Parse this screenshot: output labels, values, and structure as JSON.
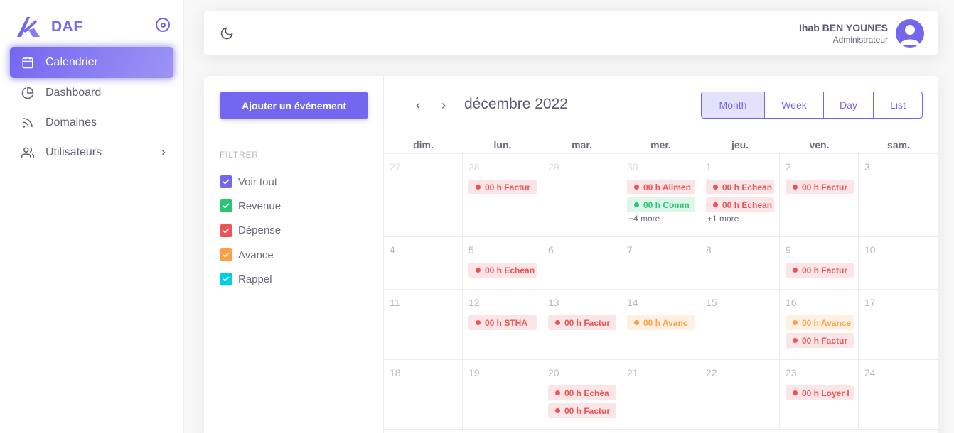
{
  "brand": {
    "name": "DAF"
  },
  "sidebar": {
    "items": [
      {
        "label": "Calendrier",
        "icon": "calendar-icon",
        "active": true
      },
      {
        "label": "Dashboard",
        "icon": "pie-chart-icon"
      },
      {
        "label": "Domaines",
        "icon": "rss-icon"
      },
      {
        "label": "Utilisateurs",
        "icon": "users-icon"
      }
    ]
  },
  "header": {
    "user_name": "Ihab BEN YOUNES",
    "user_role": "Administrateur"
  },
  "calendar": {
    "add_button": "Ajouter un événement",
    "filter_title": "FILTRER",
    "filters": [
      {
        "label": "Voir tout",
        "color": "#7367f0",
        "checked": true
      },
      {
        "label": "Revenue",
        "color": "#28c76f",
        "checked": true
      },
      {
        "label": "Dépense",
        "color": "#ea5455",
        "checked": true
      },
      {
        "label": "Avance",
        "color": "#ff9f43",
        "checked": true
      },
      {
        "label": "Rappel",
        "color": "#00cfe8",
        "checked": true
      }
    ],
    "title": "décembre 2022",
    "views": [
      "Month",
      "Week",
      "Day",
      "List"
    ],
    "active_view": "Month",
    "weekdays": [
      "dim.",
      "lun.",
      "mar.",
      "mer.",
      "jeu.",
      "ven.",
      "sam."
    ],
    "weeks": [
      [
        {
          "d": "27",
          "other": true,
          "events": []
        },
        {
          "d": "28",
          "other": true,
          "events": [
            {
              "t": "00 h Factur",
              "c": "red"
            }
          ]
        },
        {
          "d": "29",
          "other": true,
          "events": []
        },
        {
          "d": "30",
          "other": true,
          "events": [
            {
              "t": "00 h Alimen",
              "c": "red"
            },
            {
              "t": "00 h Comm",
              "c": "green"
            }
          ],
          "more": "+4 more"
        },
        {
          "d": "1",
          "events": [
            {
              "t": "00 h Echean",
              "c": "red"
            },
            {
              "t": "00 h Echean",
              "c": "red"
            }
          ],
          "more": "+1 more"
        },
        {
          "d": "2",
          "events": [
            {
              "t": "00 h Factur",
              "c": "red"
            }
          ]
        },
        {
          "d": "3",
          "events": []
        }
      ],
      [
        {
          "d": "4",
          "events": []
        },
        {
          "d": "5",
          "events": [
            {
              "t": "00 h Echean",
              "c": "red"
            }
          ]
        },
        {
          "d": "6",
          "events": []
        },
        {
          "d": "7",
          "events": []
        },
        {
          "d": "8",
          "events": []
        },
        {
          "d": "9",
          "events": [
            {
              "t": "00 h Factur",
              "c": "red"
            }
          ]
        },
        {
          "d": "10",
          "events": []
        }
      ],
      [
        {
          "d": "11",
          "events": []
        },
        {
          "d": "12",
          "events": [
            {
              "t": "00 h STHA",
              "c": "red"
            }
          ]
        },
        {
          "d": "13",
          "events": [
            {
              "t": "00 h Factur",
              "c": "red"
            }
          ]
        },
        {
          "d": "14",
          "events": [
            {
              "t": "00 h Avanc",
              "c": "orange"
            }
          ]
        },
        {
          "d": "15",
          "events": []
        },
        {
          "d": "16",
          "events": [
            {
              "t": "00 h Avance",
              "c": "orange"
            },
            {
              "t": "00 h Factur",
              "c": "red"
            }
          ]
        },
        {
          "d": "17",
          "events": []
        }
      ],
      [
        {
          "d": "18",
          "events": []
        },
        {
          "d": "19",
          "events": []
        },
        {
          "d": "20",
          "events": [
            {
              "t": "00 h Echéa",
              "c": "red"
            },
            {
              "t": "00 h Factur",
              "c": "red"
            }
          ]
        },
        {
          "d": "21",
          "events": []
        },
        {
          "d": "22",
          "events": []
        },
        {
          "d": "23",
          "events": [
            {
              "t": "00 h Loyer I",
              "c": "red"
            }
          ]
        },
        {
          "d": "24",
          "events": []
        }
      ]
    ]
  }
}
